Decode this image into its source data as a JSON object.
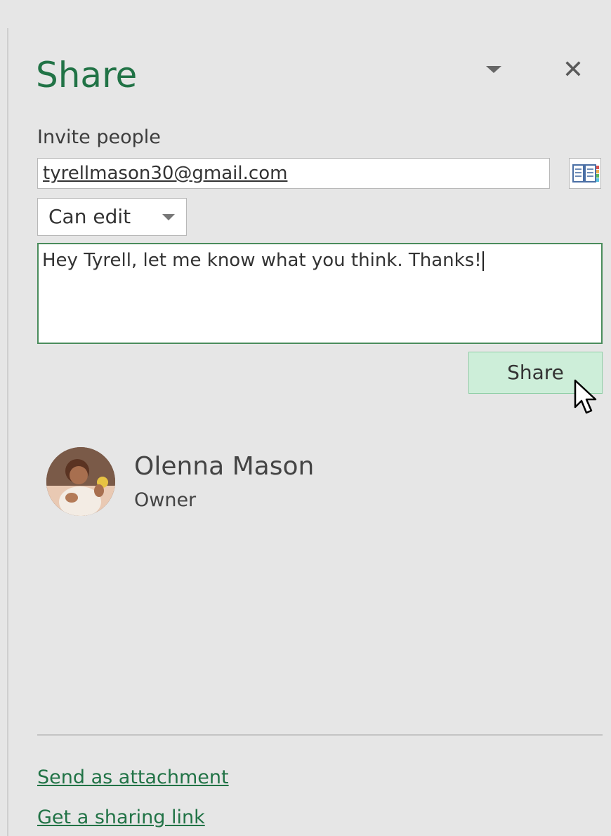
{
  "pane": {
    "title": "Share",
    "task_menu_icon": "chevron-down-icon",
    "close_icon": "close-icon",
    "close_glyph": "✕"
  },
  "invite": {
    "label": "Invite people",
    "email_value": "tyrellmason30@gmail.com",
    "address_book_icon": "address-book-icon",
    "permission_selected": "Can edit",
    "message_value": "Hey Tyrell, let me know what you think. Thanks!",
    "share_button_label": "Share"
  },
  "people": [
    {
      "name": "Olenna Mason",
      "role": "Owner",
      "avatar_icon": "avatar-photo"
    }
  ],
  "footer": {
    "send_attachment_label": "Send as attachment",
    "sharing_link_label": "Get a sharing link"
  },
  "colors": {
    "accent": "#217346",
    "background": "#e6e6e6",
    "share_button_bg": "#cdeed9",
    "message_border": "#4a8c5c"
  }
}
